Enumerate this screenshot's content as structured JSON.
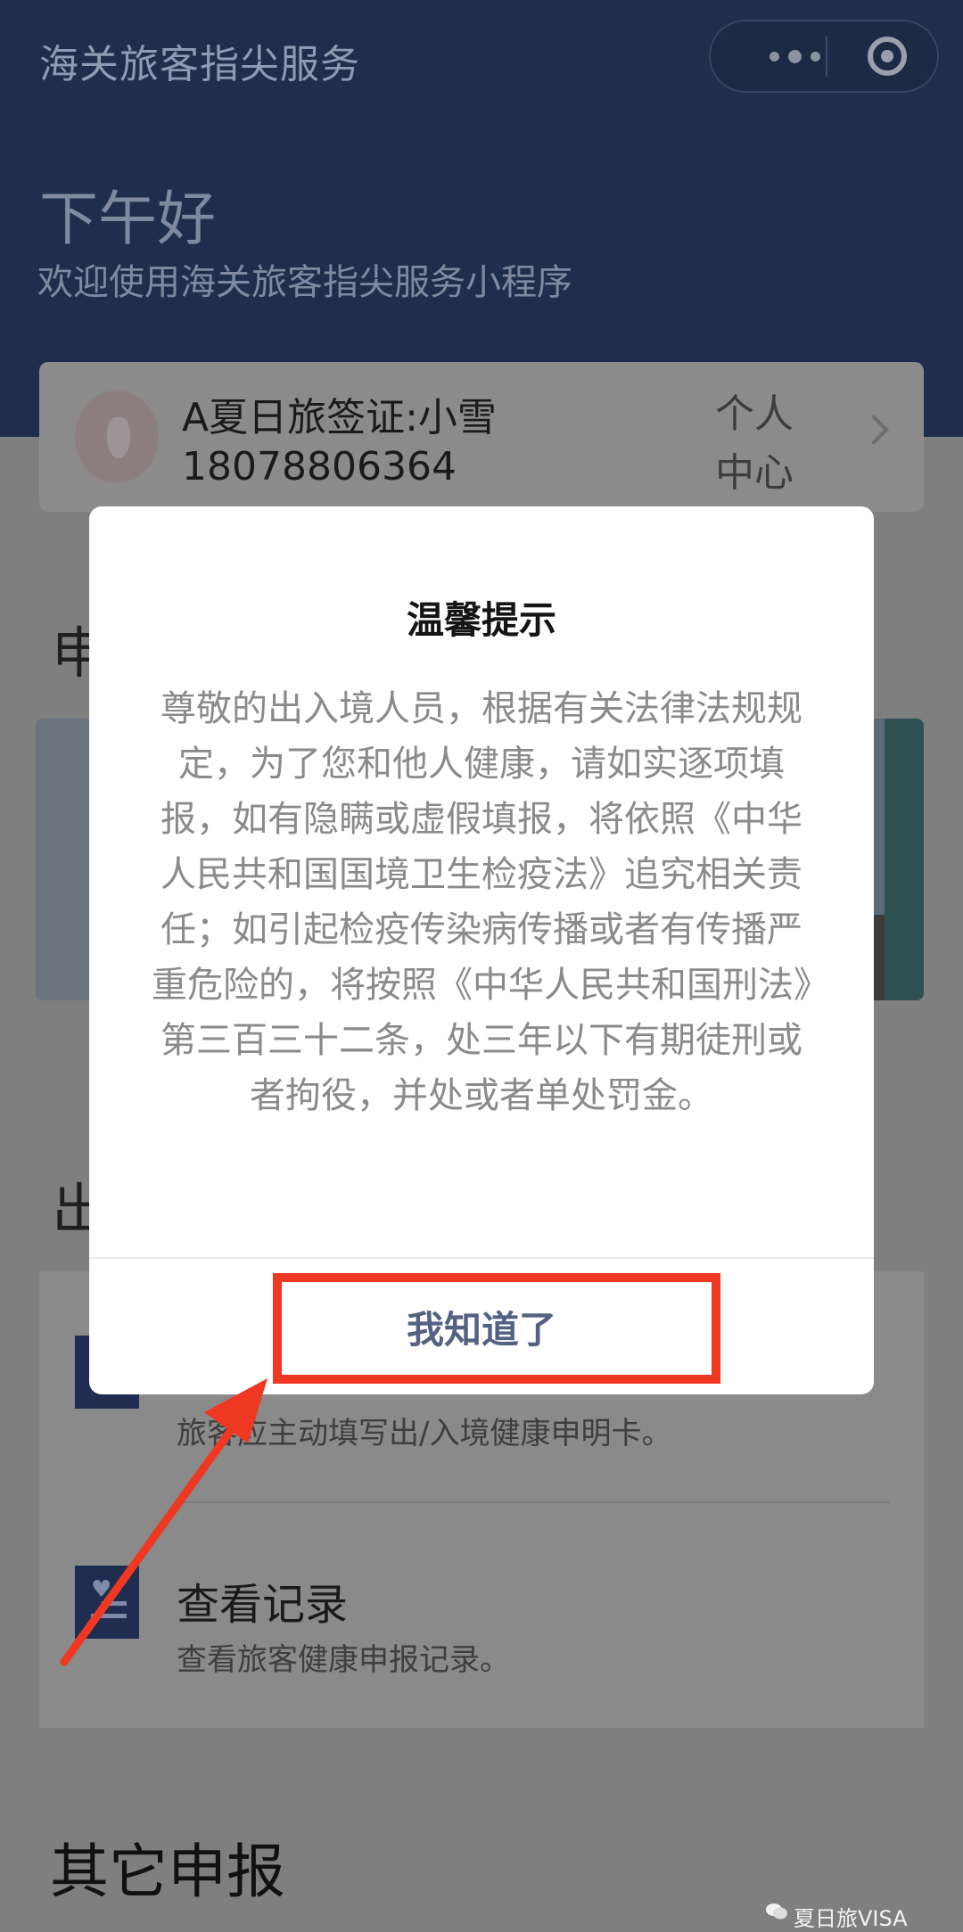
{
  "header": {
    "mp_title": "海关旅客指尖服务",
    "greeting": "下午好",
    "welcome": "欢迎使用海关旅客指尖服务小程序",
    "capsule_icons": [
      "more-icon",
      "close-target-icon"
    ]
  },
  "user": {
    "name": "A夏日旅签证:小雪",
    "phone": "18078806364",
    "center_label": "个人中心"
  },
  "sections": {
    "section1_title_visible": "申",
    "section2_title_visible": "出",
    "list": [
      {
        "title": "",
        "desc": "旅客应主动填写出/入境健康申明卡。"
      },
      {
        "title": "查看记录",
        "desc": "查看旅客健康申报记录。"
      }
    ],
    "section3_title": "其它申报"
  },
  "modal": {
    "title": "温馨提示",
    "body": "尊敬的出入境人员，根据有关法律法规规定，为了您和他人健康，请如实逐项填报，如有隐瞒或虚假填报，将依照《中华人民共和国国境卫生检疫法》追究相关责任；如引起检疫传染病传播或者有传播严重危险的，将按照《中华人民共和国刑法》第三百三十二条，处三年以下有期徒刑或者拘役，并处或者单处罚金。",
    "confirm_label": "我知道了"
  },
  "watermark": "夏日旅VISA",
  "colors": {
    "header_bg": "#1f2e4c",
    "overlay": "#7f7f7f",
    "modal_button_text": "#556182",
    "annotation_red": "#ef3822"
  }
}
